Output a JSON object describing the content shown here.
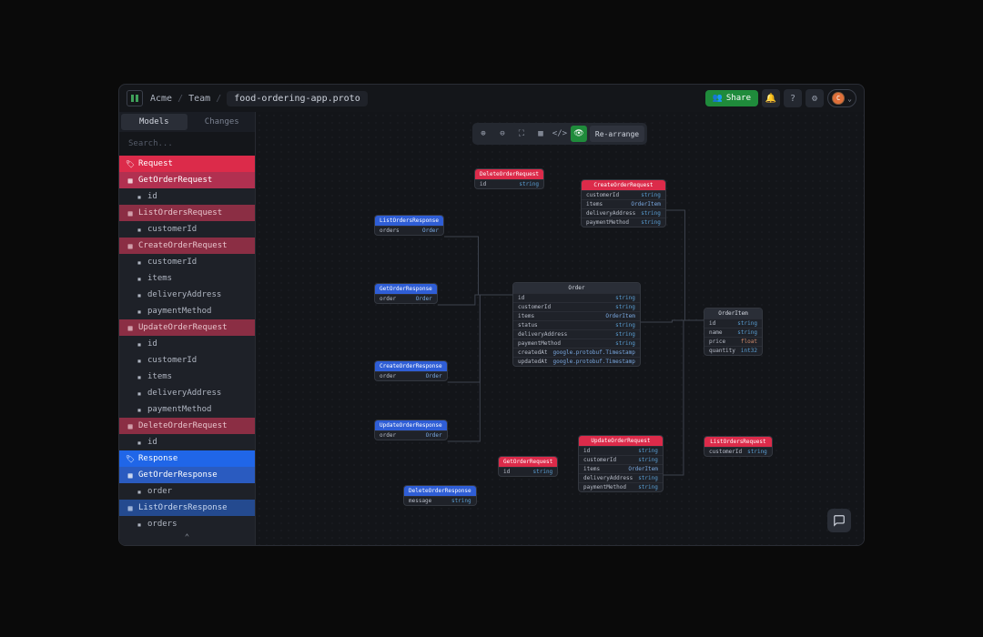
{
  "breadcrumbs": {
    "org": "Acme",
    "team": "Team",
    "file": "food-ordering-app.proto"
  },
  "topbar": {
    "share_label": "Share",
    "avatar_initial": "C"
  },
  "sidebar": {
    "tab_models": "Models",
    "tab_changes": "Changes",
    "search_placeholder": "Search...",
    "cat_request": "Request",
    "cat_response": "Response",
    "models": [
      {
        "name": "GetOrderRequest",
        "kind": "red",
        "sel": true,
        "fields": [
          "id"
        ]
      },
      {
        "name": "ListOrdersRequest",
        "kind": "red",
        "fields": [
          "customerId"
        ]
      },
      {
        "name": "CreateOrderRequest",
        "kind": "red",
        "fields": [
          "customerId",
          "items",
          "deliveryAddress",
          "paymentMethod"
        ]
      },
      {
        "name": "UpdateOrderRequest",
        "kind": "red",
        "fields": [
          "id",
          "customerId",
          "items",
          "deliveryAddress",
          "paymentMethod"
        ]
      },
      {
        "name": "DeleteOrderRequest",
        "kind": "red",
        "fields": [
          "id"
        ]
      }
    ],
    "responses": [
      {
        "name": "GetOrderResponse",
        "kind": "blue",
        "sel": true,
        "fields": [
          "order"
        ]
      },
      {
        "name": "ListOrdersResponse",
        "kind": "blue",
        "fields": [
          "orders"
        ]
      },
      {
        "name": "CreateOrderResponse",
        "kind": "blue",
        "fields": []
      }
    ]
  },
  "toolbar": {
    "rearrange": "Re-arrange"
  },
  "nodes": {
    "DeleteOrderRequest": {
      "fields": [
        [
          "id",
          "string"
        ]
      ]
    },
    "CreateOrderRequest": {
      "fields": [
        [
          "customerId",
          "string"
        ],
        [
          "items",
          "OrderItem"
        ],
        [
          "deliveryAddress",
          "string"
        ],
        [
          "paymentMethod",
          "string"
        ]
      ]
    },
    "ListOrdersResponse": {
      "fields": [
        [
          "orders",
          "Order"
        ]
      ]
    },
    "GetOrderResponse": {
      "fields": [
        [
          "order",
          "Order"
        ]
      ]
    },
    "CreateOrderResponse": {
      "fields": [
        [
          "order",
          "Order"
        ]
      ]
    },
    "UpdateOrderResponse": {
      "fields": [
        [
          "order",
          "Order"
        ]
      ]
    },
    "Order": {
      "fields": [
        [
          "id",
          "string"
        ],
        [
          "customerId",
          "string"
        ],
        [
          "items",
          "OrderItem"
        ],
        [
          "status",
          "string"
        ],
        [
          "deliveryAddress",
          "string"
        ],
        [
          "paymentMethod",
          "string"
        ],
        [
          "createdAt",
          "google.protobuf.Timestamp"
        ],
        [
          "updatedAt",
          "google.protobuf.Timestamp"
        ]
      ]
    },
    "OrderItem": {
      "fields": [
        [
          "id",
          "string"
        ],
        [
          "name",
          "string"
        ],
        [
          "price",
          "float"
        ],
        [
          "quantity",
          "int32"
        ]
      ]
    },
    "GetOrderRequest": {
      "fields": [
        [
          "id",
          "string"
        ]
      ]
    },
    "UpdateOrderRequest": {
      "fields": [
        [
          "id",
          "string"
        ],
        [
          "customerId",
          "string"
        ],
        [
          "items",
          "OrderItem"
        ],
        [
          "deliveryAddress",
          "string"
        ],
        [
          "paymentMethod",
          "string"
        ]
      ]
    },
    "DeleteOrderResponse": {
      "fields": [
        [
          "message",
          "string"
        ]
      ]
    },
    "ListOrdersRequest": {
      "fields": [
        [
          "customerId",
          "string"
        ]
      ]
    }
  }
}
